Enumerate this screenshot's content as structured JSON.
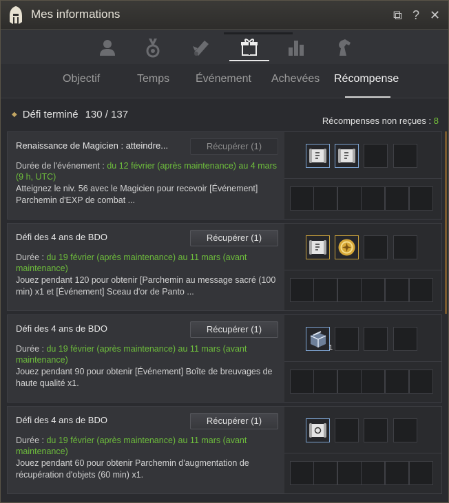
{
  "window": {
    "title": "Mes informations",
    "close_glyph": "✕",
    "help_glyph": "?",
    "restore_glyph": "⧉"
  },
  "icon_tabs": [
    {
      "icon": "profile-icon",
      "active": false
    },
    {
      "icon": "medal-icon",
      "active": false
    },
    {
      "icon": "scroll-icon",
      "active": false
    },
    {
      "icon": "gift-icon",
      "active": true
    },
    {
      "icon": "chart-icon",
      "active": false
    },
    {
      "icon": "horse-icon",
      "active": false
    }
  ],
  "tabs": [
    {
      "label": "Objectif",
      "active": false
    },
    {
      "label": "Temps",
      "active": false
    },
    {
      "label": "Événement",
      "active": false
    },
    {
      "label": "Achevées",
      "active": false
    },
    {
      "label": "Récompense",
      "active": true
    }
  ],
  "summary": {
    "label": "Défi terminé",
    "count": "130 / 137",
    "unclaimed_label": "Récompenses non reçues :",
    "unclaimed_count": "8"
  },
  "cards": [
    {
      "title": "Renaissance de Magicien : atteindre...",
      "button": "Récupérer (1)",
      "button_dim": true,
      "duration_label": "Durée de l'événement :",
      "duration": " du 12 février (après maintenance) au 4 mars (9 h, UTC)",
      "desc": "Atteignez le niv. 56 avec le Magicien pour recevoir [Événement] Parchemin d'EXP de combat ...",
      "rewards": [
        {
          "icon": "scroll-item-icon",
          "style": "blue",
          "qty": ""
        },
        {
          "icon": "scroll-item-icon",
          "style": "blue",
          "qty": ""
        }
      ]
    },
    {
      "title": "Défi des 4 ans de BDO",
      "button": "Récupérer (1)",
      "button_dim": false,
      "duration_label": "Durée :",
      "duration": " du 19 février (après maintenance) au 11 mars (avant maintenance)",
      "desc": "Jouez pendant 120 pour obtenir [Parchemin au message sacré (100 min) x1 et [Événement] Sceau d'or de Panto ...",
      "rewards": [
        {
          "icon": "scroll-item-icon",
          "style": "gold",
          "qty": ""
        },
        {
          "icon": "gold-seal-icon",
          "style": "gold",
          "qty": ""
        }
      ]
    },
    {
      "title": "Défi des 4 ans de BDO",
      "button": "Récupérer (1)",
      "button_dim": false,
      "duration_label": "Durée :",
      "duration": " du 19 février (après maintenance) au 11 mars (avant maintenance)",
      "desc": "Jouez pendant 90 pour obtenir [Événement] Boîte de breuvages de haute qualité x1.",
      "rewards": [
        {
          "icon": "box-item-icon",
          "style": "blue",
          "qty": "1"
        }
      ]
    },
    {
      "title": "Défi des 4 ans de BDO",
      "button": "Récupérer (1)",
      "button_dim": false,
      "duration_label": "Durée :",
      "duration": " du 19 février (après maintenance) au 11 mars (avant maintenance)",
      "desc": "Jouez pendant 60 pour obtenir Parchemin d'augmentation de récupération d'objets (60 min) x1.",
      "rewards": [
        {
          "icon": "scroll-item-icon",
          "style": "blue",
          "qty": ""
        }
      ]
    }
  ]
}
